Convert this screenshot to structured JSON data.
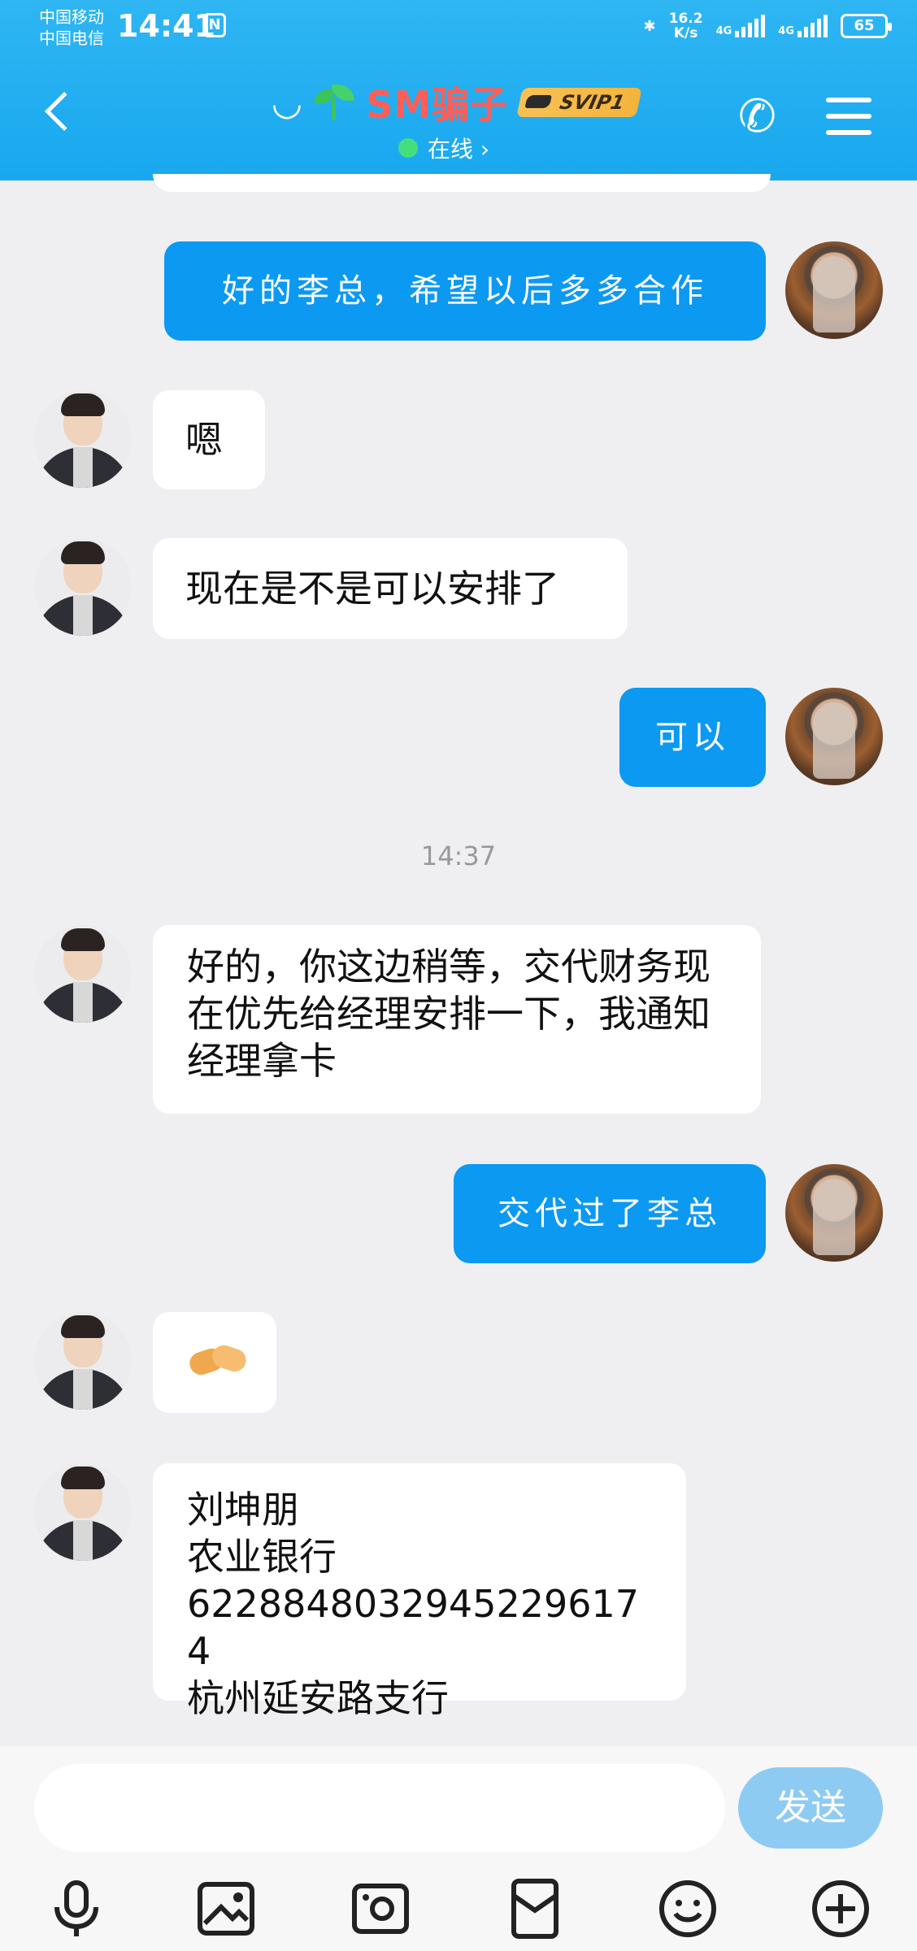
{
  "status": {
    "carrier1": "中国移动",
    "carrier2": "中国电信",
    "time": "14:41",
    "nfc": "N",
    "speed": "16.2\nK/s",
    "net1": "4G",
    "net2": "4G",
    "battery": "65"
  },
  "header": {
    "name": "SM骗子",
    "vip": "SVIP1",
    "presence": "在线 ›",
    "back_icon": "chevron-left-icon",
    "phone_icon": "phone-icon",
    "menu_icon": "menu-icon"
  },
  "messages": [
    {
      "side": "out",
      "text": "好的李总，希望以后多多合作"
    },
    {
      "side": "in",
      "text": "嗯"
    },
    {
      "side": "in",
      "text": "现在是不是可以安排了"
    },
    {
      "side": "out",
      "text": "可以"
    },
    {
      "side": "in",
      "text": "好的，你这边稍等，交代财务现在优先给经理安排一下，我通知经理拿卡"
    },
    {
      "side": "out",
      "text": "交代过了李总"
    },
    {
      "side": "in",
      "text": ""
    },
    {
      "side": "in",
      "text": "刘坤朋\n农业银行\n6228848032945229617 4\n杭州延安路支行"
    }
  ],
  "timestamp": "14:37",
  "composer": {
    "send_label": "发送",
    "tools": [
      "microphone-icon",
      "image-icon",
      "camera-icon",
      "red-packet-icon",
      "emoji-icon",
      "plus-icon"
    ]
  },
  "colors": {
    "header": "#18a8ef",
    "out_bubble": "#0b99f2",
    "send_button": "#8ecbf3",
    "online_dot": "#45de7f"
  }
}
